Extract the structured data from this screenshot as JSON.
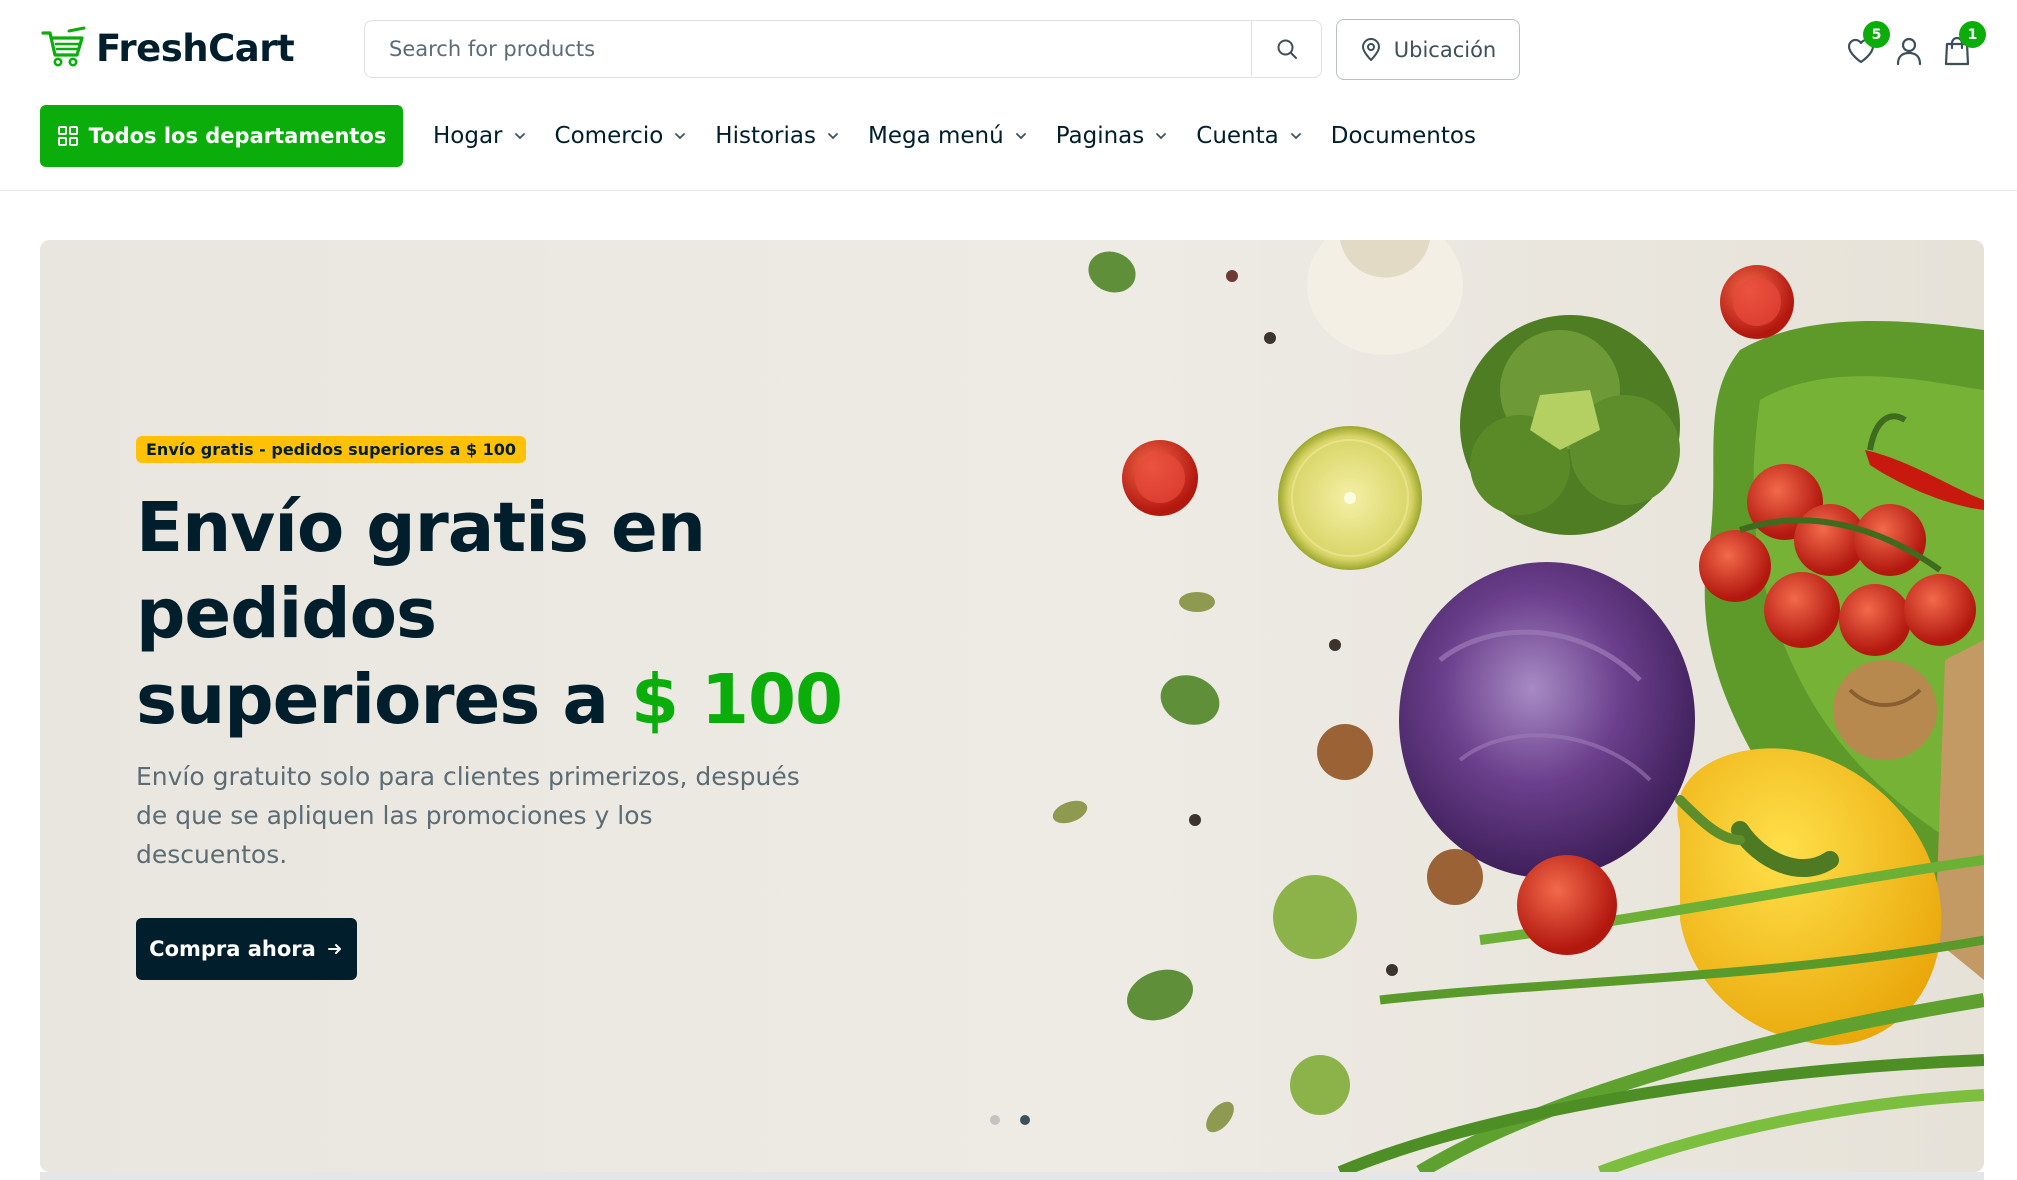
{
  "brand": {
    "name": "FreshCart",
    "accent": "#0aad0a",
    "dark": "#001e2b"
  },
  "header": {
    "search_placeholder": "Search for products",
    "location_label": "Ubicación",
    "wishlist_count": "5",
    "cart_count": "1",
    "icons": [
      "search-icon",
      "map-pin-icon",
      "heart-icon",
      "user-icon",
      "shopping-bag-icon"
    ]
  },
  "nav": {
    "departments_label": "Todos los departamentos",
    "items": [
      {
        "label": "Hogar",
        "dropdown": true
      },
      {
        "label": "Comercio",
        "dropdown": true
      },
      {
        "label": "Historias",
        "dropdown": true
      },
      {
        "label": "Mega menú",
        "dropdown": true
      },
      {
        "label": "Paginas",
        "dropdown": true
      },
      {
        "label": "Cuenta",
        "dropdown": true
      },
      {
        "label": "Documentos",
        "dropdown": false
      }
    ]
  },
  "hero": {
    "badge": "Envío gratis - pedidos superiores a $ 100",
    "title_line1": "Envío gratis en",
    "title_line2": "pedidos",
    "title_line3": "superiores a",
    "title_price": "$ 100",
    "subtitle": "Envío gratuito solo para clientes primerizos, después de que se apliquen las promociones y los descuentos.",
    "cta_label": "Compra ahora",
    "slides_total": 2,
    "active_slide": 2
  }
}
